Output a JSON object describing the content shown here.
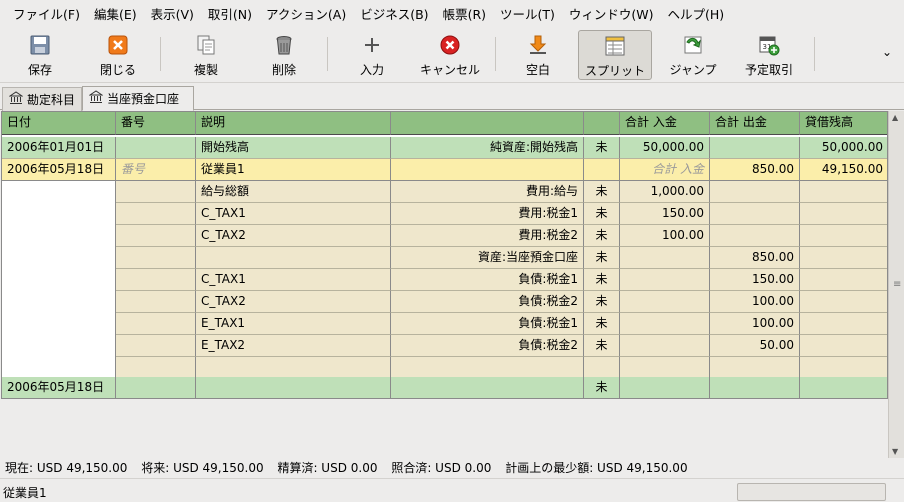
{
  "menu": [
    "ファイル(F)",
    "編集(E)",
    "表示(V)",
    "取引(N)",
    "アクション(A)",
    "ビジネス(B)",
    "帳票(R)",
    "ツール(T)",
    "ウィンドウ(W)",
    "ヘルプ(H)"
  ],
  "toolbar": {
    "save": "保存",
    "close": "閉じる",
    "duplicate": "複製",
    "delete": "削除",
    "enter": "入力",
    "cancel": "キャンセル",
    "blank": "空白",
    "split": "スプリット",
    "jump": "ジャンプ",
    "schedule": "予定取引",
    "more": "⌄"
  },
  "tabs": {
    "accounts": "勘定科目",
    "checking": "当座預金口座"
  },
  "register": {
    "headers": {
      "date": "日付",
      "num": "番号",
      "desc": "説明",
      "transfer": "",
      "r": "",
      "deposit": "合計 入金",
      "withdrawal": "合計 出金",
      "balance": "貸借残高"
    },
    "rows": [
      {
        "date": "2006年01月01日",
        "num": "",
        "desc": "開始残高",
        "transfer": "純資産:開始残高",
        "r": "未",
        "deposit": "50,000.00",
        "withdrawal": "",
        "balance": "50,000.00"
      },
      {
        "date": "2006年05月18日",
        "num": "番号",
        "desc": "従業員1",
        "transfer": "",
        "r": "",
        "deposit": "合計 入金",
        "withdrawal": "850.00",
        "balance": "49,150.00"
      }
    ],
    "splits": [
      {
        "desc": "給与総額",
        "account": "費用:給与",
        "r": "未",
        "deposit": "1,000.00",
        "withdrawal": ""
      },
      {
        "desc": "C_TAX1",
        "account": "費用:税金1",
        "r": "未",
        "deposit": "150.00",
        "withdrawal": ""
      },
      {
        "desc": "C_TAX2",
        "account": "費用:税金2",
        "r": "未",
        "deposit": "100.00",
        "withdrawal": ""
      },
      {
        "desc": "",
        "account": "資産:当座預金口座",
        "r": "未",
        "deposit": "",
        "withdrawal": "850.00"
      },
      {
        "desc": "C_TAX1",
        "account": "負債:税金1",
        "r": "未",
        "deposit": "",
        "withdrawal": "150.00"
      },
      {
        "desc": "C_TAX2",
        "account": "負債:税金2",
        "r": "未",
        "deposit": "",
        "withdrawal": "100.00"
      },
      {
        "desc": "E_TAX1",
        "account": "負債:税金1",
        "r": "未",
        "deposit": "",
        "withdrawal": "100.00"
      },
      {
        "desc": "E_TAX2",
        "account": "負債:税金2",
        "r": "未",
        "deposit": "",
        "withdrawal": "50.00"
      },
      {
        "desc": "",
        "account": "",
        "r": "",
        "deposit": "",
        "withdrawal": ""
      }
    ],
    "blank_row": {
      "date": "2006年05月18日",
      "r": "未"
    }
  },
  "summary": {
    "present": "現在: USD 49,150.00",
    "future": "将来: USD 49,150.00",
    "cleared": "精算済: USD 0.00",
    "reconciled": "照合済: USD 0.00",
    "min": "計画上の最少額: USD 49,150.00"
  },
  "status": "従業員1",
  "colors": {
    "header": "#8fbf82",
    "green_row": "#bfe0b8",
    "current_row": "#fbeeaa",
    "split_row": "#efe7cc"
  }
}
